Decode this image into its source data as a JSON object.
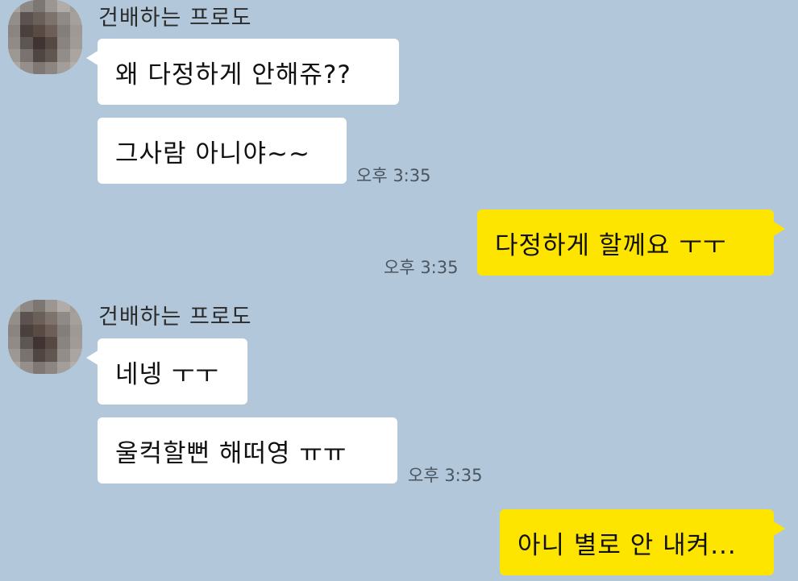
{
  "group1": {
    "sender": "건배하는 프로도",
    "messages": [
      "왜 다정하게 안해쥬??",
      "그사람 아니야~~"
    ],
    "time": "오후 3:35"
  },
  "reply1": {
    "message": "다정하게 할께요 ㅜㅜ",
    "time": "오후 3:35"
  },
  "group2": {
    "sender": "건배하는 프로도",
    "messages": [
      "네넹 ㅜㅜ",
      "울컥할뻔 해떠영 ㅠㅠ"
    ],
    "time": "오후 3:35"
  },
  "reply2": {
    "message": "아니 별로 안 내켜..."
  },
  "colors": {
    "background": "#b2c7d9",
    "incoming_bubble": "#ffffff",
    "outgoing_bubble": "#fee500"
  }
}
